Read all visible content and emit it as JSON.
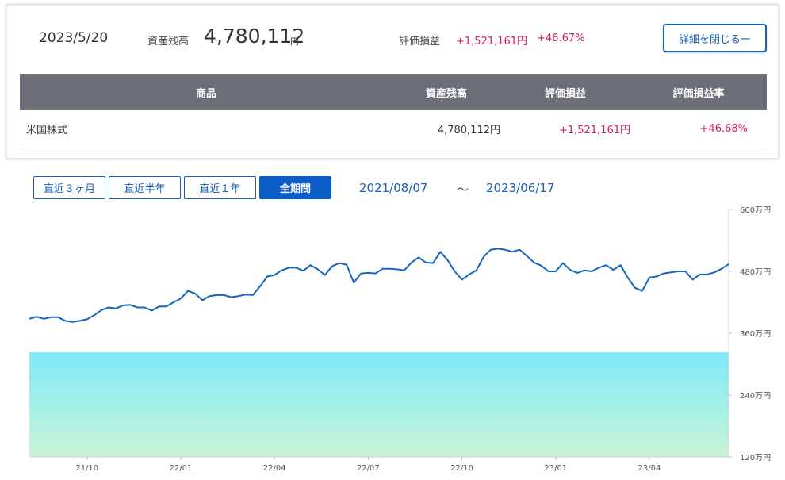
{
  "summary": {
    "date": "2023/5/20",
    "balance_label": "資産残高",
    "balance_value": "4,780,112",
    "balance_unit": "円",
    "pl_label": "評価損益",
    "pl_value": "+1,521,161円",
    "pl_rate": "+46.67%",
    "close_button_label": "詳細を閉じるー"
  },
  "table": {
    "headers": [
      "商品",
      "資産残高",
      "評価損益",
      "評価損益率"
    ],
    "rows": [
      {
        "name": "米国株式",
        "balance": "4,780,112円",
        "pl": "+1,521,161円",
        "rate": "+46.68%"
      }
    ]
  },
  "periods": [
    {
      "label": "直近３ヶ月",
      "active": false
    },
    {
      "label": "直近半年",
      "active": false
    },
    {
      "label": "直近１年",
      "active": false
    },
    {
      "label": "全期間",
      "active": true
    }
  ],
  "range": {
    "start": "2021/08/07",
    "separator": "～",
    "end": "2023/06/17"
  },
  "colors": {
    "accent": "#1a5fb4",
    "positive": "#d81b60",
    "line": "#1565c0",
    "area_top": "#7eeaf8",
    "area_bottom": "#c9f5d6"
  },
  "chart_data": {
    "type": "line",
    "ylim": [
      120,
      600
    ],
    "yticks": [
      "120万円",
      "240万円",
      "360万円",
      "480万円",
      "600万円"
    ],
    "ytick_values": [
      120,
      240,
      360,
      480,
      600
    ],
    "xticks": [
      "21/10",
      "22/01",
      "22/04",
      "22/07",
      "22/10",
      "23/01",
      "23/04"
    ],
    "xtick_index": [
      8,
      21,
      34,
      47,
      60,
      73,
      86
    ],
    "baseline_area_value": 323,
    "series": [
      {
        "values": [
          388,
          392,
          388,
          391,
          391,
          384,
          382,
          384,
          387,
          395,
          405,
          410,
          408,
          414,
          415,
          410,
          410,
          404,
          412,
          412,
          420,
          427,
          442,
          437,
          424,
          432,
          434,
          434,
          430,
          432,
          435,
          434,
          451,
          470,
          473,
          482,
          487,
          487,
          481,
          492,
          484,
          473,
          490,
          496,
          493,
          458,
          476,
          477,
          476,
          485,
          485,
          484,
          482,
          497,
          507,
          497,
          496,
          518,
          502,
          480,
          464,
          474,
          482,
          508,
          522,
          524,
          522,
          518,
          522,
          510,
          497,
          491,
          480,
          480,
          496,
          483,
          477,
          482,
          480,
          487,
          492,
          483,
          492,
          468,
          448,
          442,
          468,
          470,
          476,
          478,
          480,
          480,
          464,
          474,
          474,
          478,
          485,
          494
        ]
      }
    ]
  }
}
